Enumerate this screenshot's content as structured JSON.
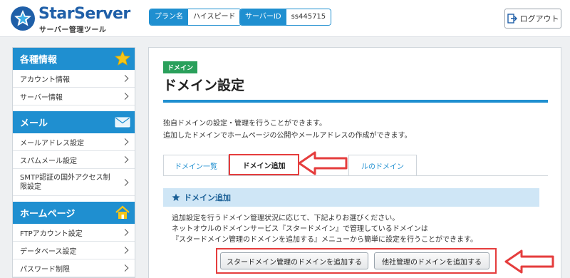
{
  "header": {
    "logo_name": "StarServer",
    "logo_sub": "サーバー管理ツール",
    "plan_label": "プラン名",
    "plan_value": "ハイスピード",
    "server_label": "サーバーID",
    "server_value": "ss445715",
    "logout_label": "ログアウト"
  },
  "sidebar": {
    "sections": [
      {
        "title": "各種情報",
        "icon": "star-icon",
        "items": [
          "アカウント情報",
          "サーバー情報"
        ]
      },
      {
        "title": "メール",
        "icon": "mail-icon",
        "items": [
          "メールアドレス設定",
          "スパムメール設定",
          "SMTP認証の国外アクセス制限設定"
        ]
      },
      {
        "title": "ホームページ",
        "icon": "home-icon",
        "items": [
          "FTPアカウント設定",
          "データベース設定",
          "パスワード制限"
        ]
      }
    ]
  },
  "main": {
    "tag": "ドメイン",
    "title": "ドメイン設定",
    "desc_line1": "独自ドメインの設定・管理を行うことができます。",
    "desc_line2": "追加したドメインでホームページの公開やメールアドレスの作成ができます。",
    "tabs": [
      "ドメイン一覧",
      "ドメイン追加",
      "ルのドメイン"
    ],
    "section_title": "ドメイン追加",
    "section_line1": "追加設定を行うドメイン管理状況に応じて、下記よりお選びください。",
    "section_line2": "ネットオウルのドメインサービス『スタードメイン』で管理しているドメインは",
    "section_line3": "『スタードメイン管理のドメインを追加する』メニューから簡単に設定を行うことができます。",
    "button_star": "スタードメイン管理のドメインを追加する",
    "button_other": "他社管理のドメインを追加する"
  },
  "colors": {
    "accent": "#1f8fd0",
    "highlight": "#e53d3d",
    "tag": "#2aa05b"
  }
}
